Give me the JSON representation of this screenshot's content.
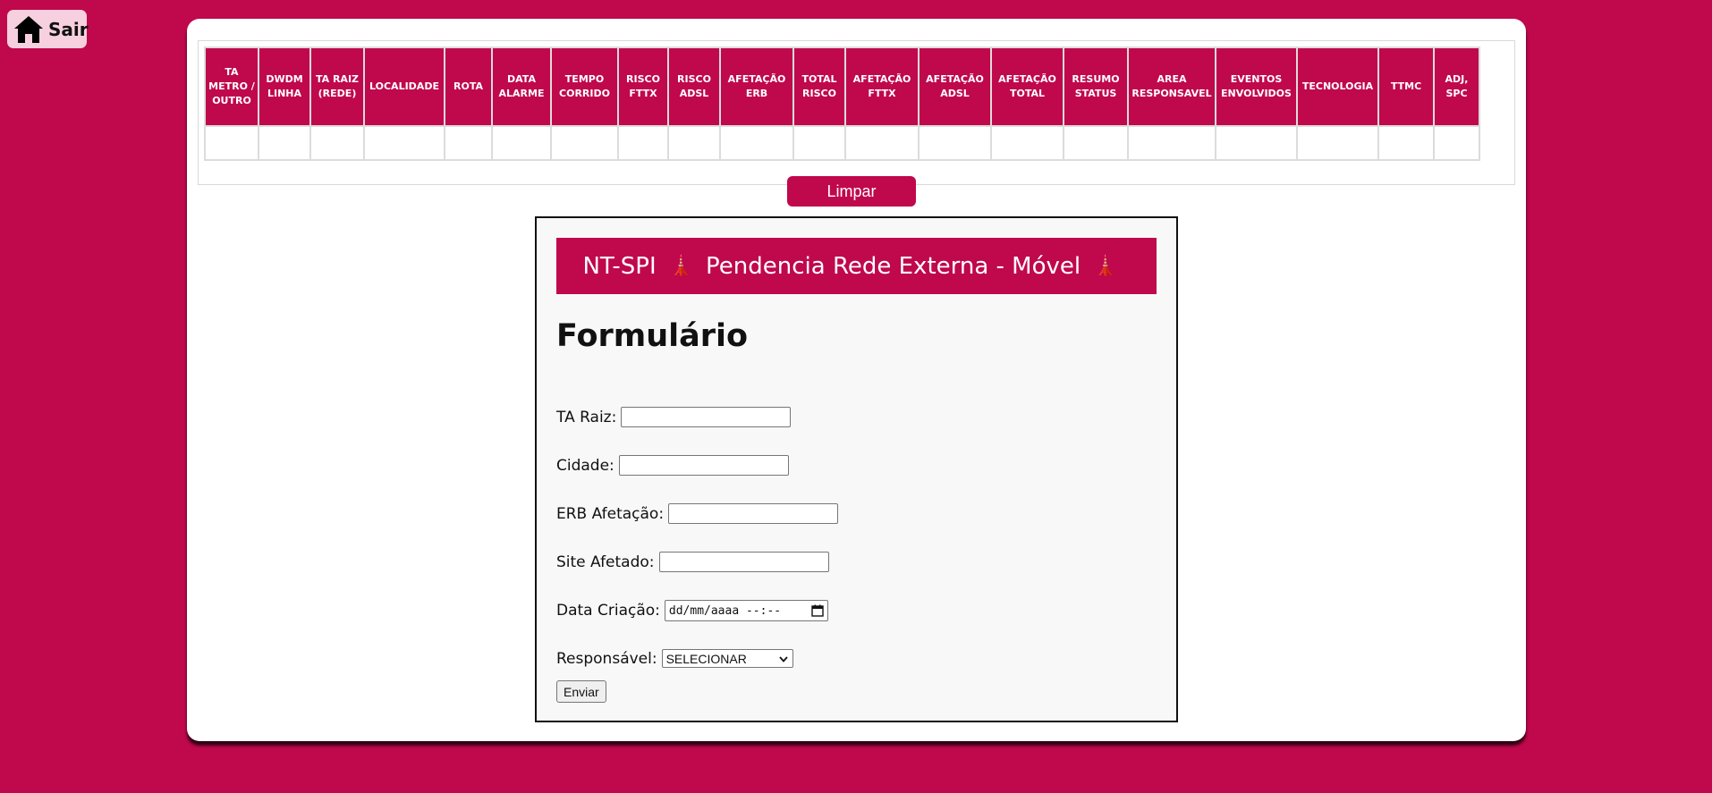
{
  "exit_button": {
    "label": "Sair",
    "icon": "home-icon"
  },
  "table": {
    "headers": [
      "TA METRO / OUTRO",
      "DWDM LINHA",
      "TA RAIZ (REDE)",
      "LOCALIDADE",
      "ROTA",
      "DATA ALARME",
      "TEMPO CORRIDO",
      "RISCO FTTX",
      "RISCO ADSL",
      "AFETAÇÃO ERB",
      "TOTAL RISCO",
      "AFETAÇÃO FTTX",
      "AFETAÇÃO ADSL",
      "AFETAÇÃO TOTAL",
      "RESUMO STATUS",
      "AREA RESPONSAVEL",
      "EVENTOS ENVOLVIDOS",
      "TECNOLOGIA",
      "TTMC",
      "ADJ, SPC"
    ],
    "rows": [
      [
        "",
        "",
        "",
        "",
        "",
        "",
        "",
        "",
        "",
        "",
        "",
        "",
        "",
        "",
        "",
        "",
        "",
        "",
        "",
        ""
      ]
    ]
  },
  "clear_button": {
    "label": "Limpar"
  },
  "form": {
    "banner": {
      "prefix": "NT-SPI",
      "title": "Pendencia Rede Externa - Móvel",
      "icon_glyph": "🗼"
    },
    "heading": "Formulário",
    "fields": {
      "ta_raiz": {
        "label": "TA Raiz:",
        "value": ""
      },
      "cidade": {
        "label": "Cidade:",
        "value": ""
      },
      "erb_afetacao": {
        "label": "ERB Afetação:",
        "value": ""
      },
      "site_afetado": {
        "label": "Site Afetado:",
        "value": ""
      },
      "data_criacao": {
        "label": "Data Criação:",
        "placeholder": "dd/mm/aaaa --:--"
      },
      "responsavel": {
        "label": "Responsável:",
        "selected": "SELECIONAR"
      }
    },
    "submit_label": "Enviar"
  },
  "colors": {
    "brand": "#c0084c",
    "exit_button_bg": "#f6d0de",
    "card_bg": "#ffffff",
    "form_bg": "#f8f8f8"
  }
}
